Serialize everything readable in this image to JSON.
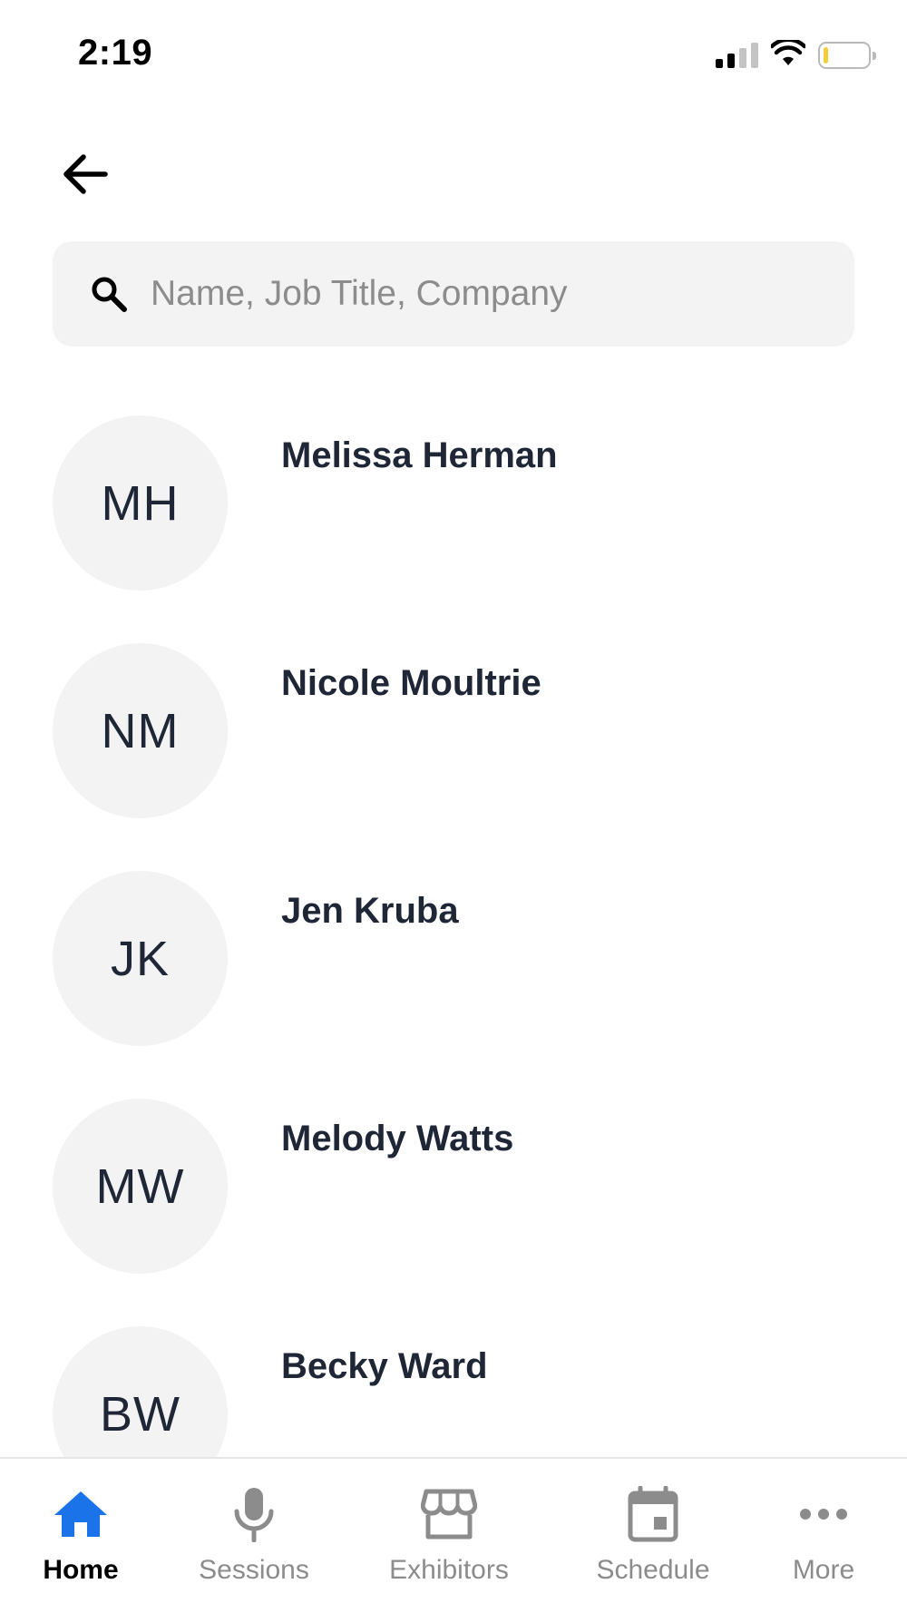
{
  "status_bar": {
    "time": "2:19",
    "battery_level": 0.1,
    "signal_bars_active": 2,
    "signal_bars_total": 4
  },
  "search": {
    "value": "",
    "placeholder": "Name, Job Title, Company"
  },
  "people": [
    {
      "initials": "MH",
      "name": "Melissa Herman"
    },
    {
      "initials": "NM",
      "name": "Nicole Moultrie"
    },
    {
      "initials": "JK",
      "name": "Jen Kruba"
    },
    {
      "initials": "MW",
      "name": "Melody Watts"
    },
    {
      "initials": "BW",
      "name": "Becky Ward"
    }
  ],
  "tabs": [
    {
      "label": "Home",
      "icon": "home-icon",
      "active": true
    },
    {
      "label": "Sessions",
      "icon": "microphone-icon",
      "active": false
    },
    {
      "label": "Exhibitors",
      "icon": "storefront-icon",
      "active": false
    },
    {
      "label": "Schedule",
      "icon": "calendar-icon",
      "active": false
    },
    {
      "label": "More",
      "icon": "more-dots-icon",
      "active": false
    }
  ],
  "colors": {
    "accent": "#1a73e8",
    "text": "#1f2636",
    "inactive": "#8c8c8c",
    "avatar_bg": "#f3f3f3"
  }
}
